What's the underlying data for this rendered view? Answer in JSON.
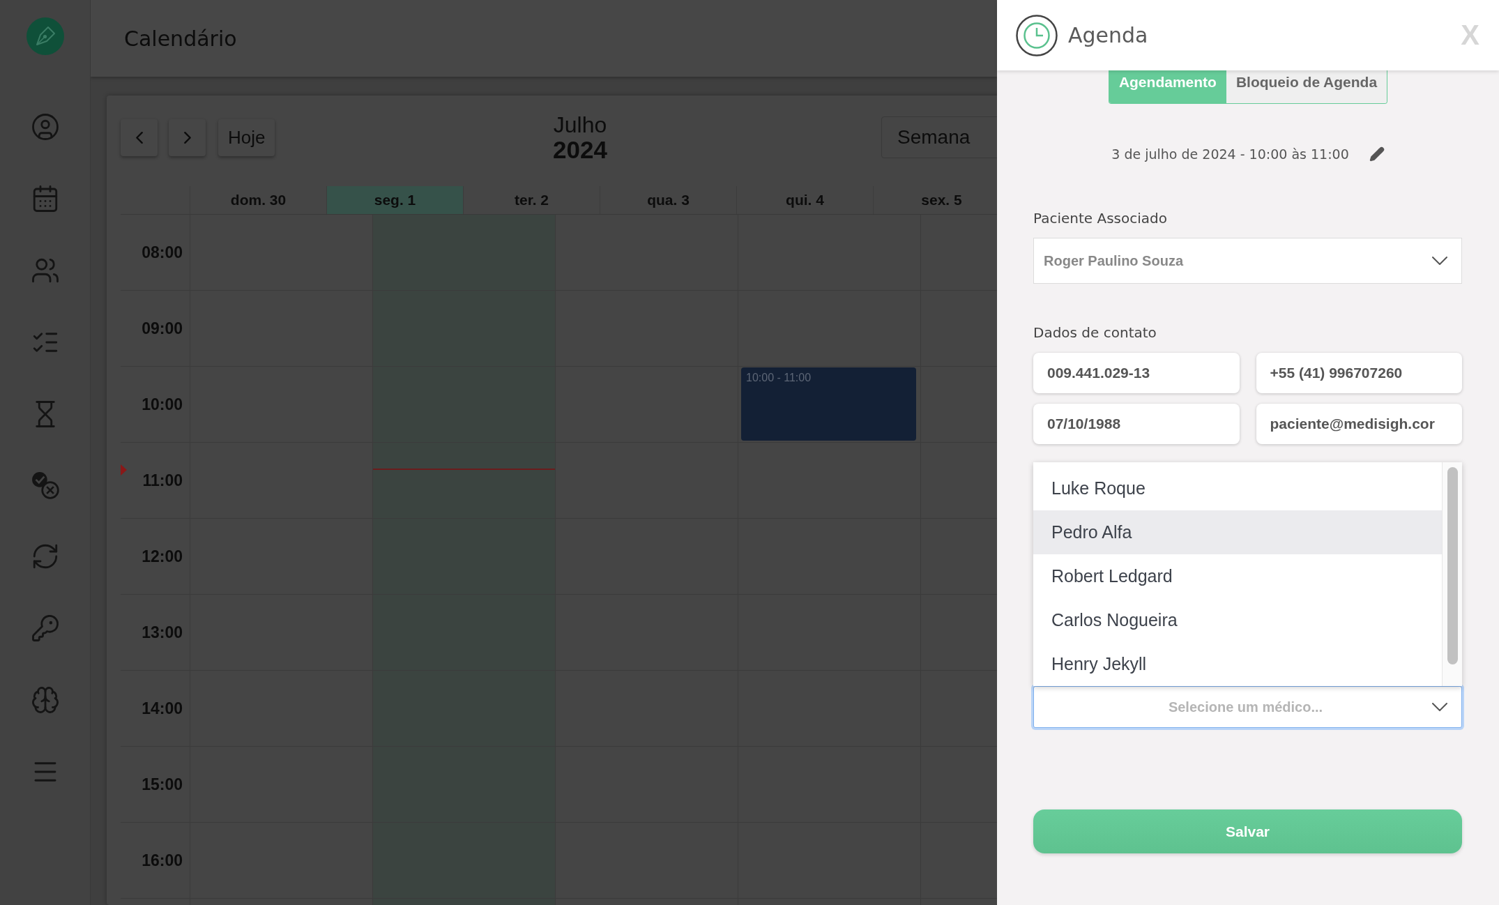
{
  "header": {
    "title": "Calendário"
  },
  "toolbar": {
    "today_button": "Hoje",
    "month": "Julho",
    "year": "2024",
    "view": "Semana"
  },
  "days": [
    {
      "label": "dom. 30",
      "today": false
    },
    {
      "label": "seg. 1",
      "today": true
    },
    {
      "label": "ter. 2",
      "today": false
    },
    {
      "label": "qua. 3",
      "today": false,
      "events": [
        {
          "label": "10:00 - 11:00"
        }
      ]
    },
    {
      "label": "qui. 4",
      "today": false
    },
    {
      "label": "sex. 5",
      "today": false
    }
  ],
  "hours": [
    "08:00",
    "09:00",
    "10:00",
    "11:00",
    "12:00",
    "13:00",
    "14:00",
    "15:00",
    "16:00"
  ],
  "now_indicator": {
    "level": 0.37
  },
  "panel": {
    "title": "Agenda",
    "close": "X",
    "tabs": [
      {
        "label": "Agendamento",
        "selected": true
      },
      {
        "label": "Bloqueio de Agenda",
        "selected": false
      }
    ],
    "date_line": "3 de julho de 2024 - 10:00 às 11:00",
    "patient": {
      "label": "Paciente Associado",
      "value": "Roger Paulino Souza"
    },
    "contact": {
      "label": "Dados de contato",
      "fields": [
        "009.441.029-13",
        "+55 (41) 996707260",
        "07/10/1988",
        "paciente@medisigh.cor"
      ]
    },
    "doctor_select": {
      "placeholder": "Selecione um médico...",
      "focused": true,
      "expanded": true,
      "options": [
        {
          "label": "Luke Roque",
          "selected": false
        },
        {
          "label": "Pedro Alfa",
          "selected": true
        },
        {
          "label": "Robert Ledgard",
          "selected": false
        },
        {
          "label": "Carlos Nogueira",
          "selected": false
        },
        {
          "label": "Henry Jekyll",
          "selected": false
        }
      ]
    },
    "save_button": "Salvar"
  }
}
